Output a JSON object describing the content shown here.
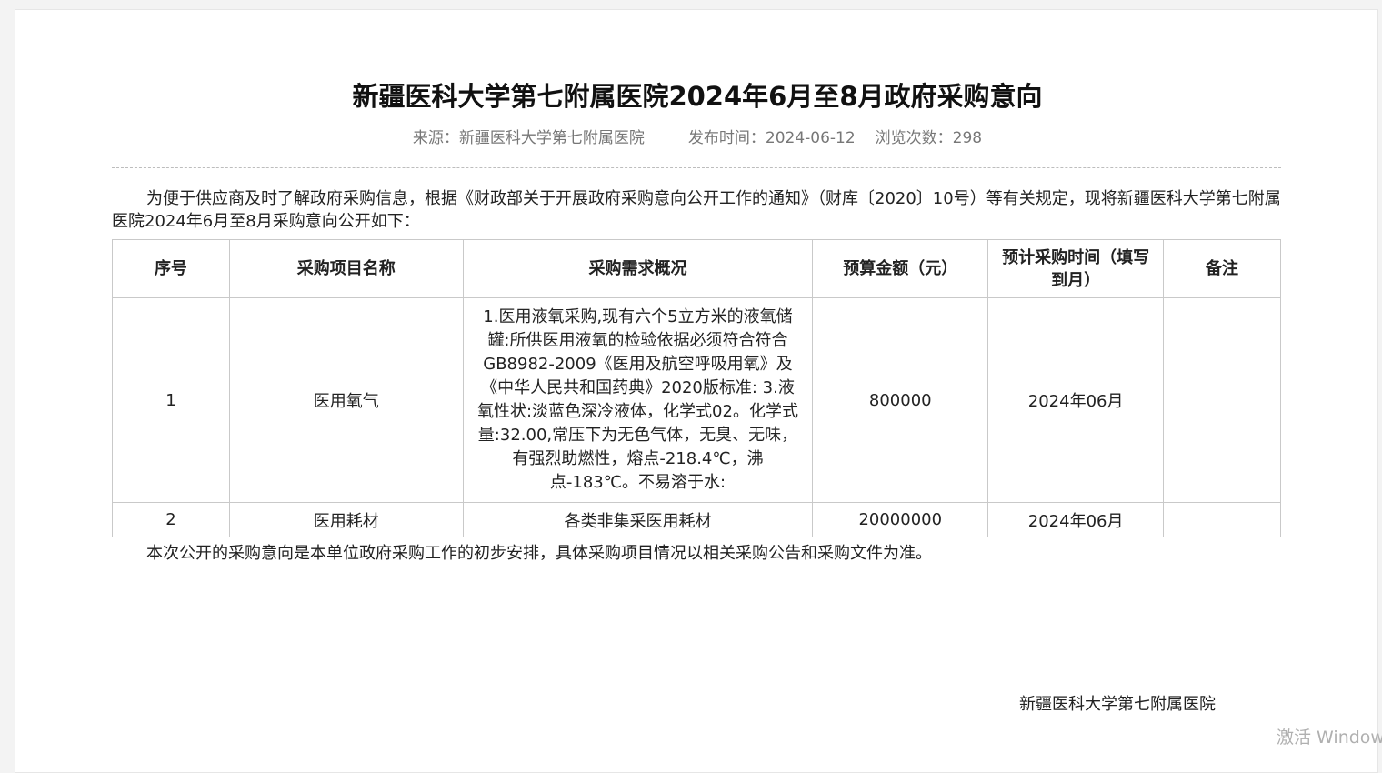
{
  "article": {
    "title": "新疆医科大学第七附属医院2024年6月至8月政府采购意向",
    "meta": {
      "source": "来源：新疆医科大学第七附属医院",
      "publish_time": "发布时间：2024-06-12",
      "views": "浏览次数：298"
    },
    "intro": "为便于供应商及时了解政府采购信息，根据《财政部关于开展政府采购意向公开工作的通知》（财库〔2020〕10号）等有关规定，现将新疆医科大学第七附属医院2024年6月至8月采购意向公开如下：",
    "table": {
      "headers": [
        "序号",
        "采购项目名称",
        "采购需求概况",
        "预算金额（元）",
        "预计采购时间（填写到月）",
        "备注"
      ],
      "rows": [
        {
          "no": "1",
          "name": "医用氧气",
          "desc": "1.医用液氧采购,现有六个5立方米的液氧储罐:所供医用液氧的检验依据必须符合符合 GB8982-2009《医用及航空呼吸用氧》及《中华人民共和国药典》2020版标准: 3.液氧性状:淡蓝色深冷液体，化学式02。化学式量:32.00,常压下为无色气体，无臭、无味，有强烈助燃性，熔点-218.4℃，沸点-183℃。不易溶于水:",
          "budget": "800000",
          "time": "2024年06月",
          "remark": ""
        },
        {
          "no": "2",
          "name": "医用耗材",
          "desc": "各类非集采医用耗材",
          "budget": "20000000",
          "time": "2024年06月",
          "remark": ""
        }
      ]
    },
    "outro": "本次公开的采购意向是本单位政府采购工作的初步安排，具体采购项目情况以相关采购公告和采购文件为准。",
    "signature": "新疆医科大学第七附属医院"
  },
  "overlay": {
    "watermark": "激活 Windows"
  }
}
